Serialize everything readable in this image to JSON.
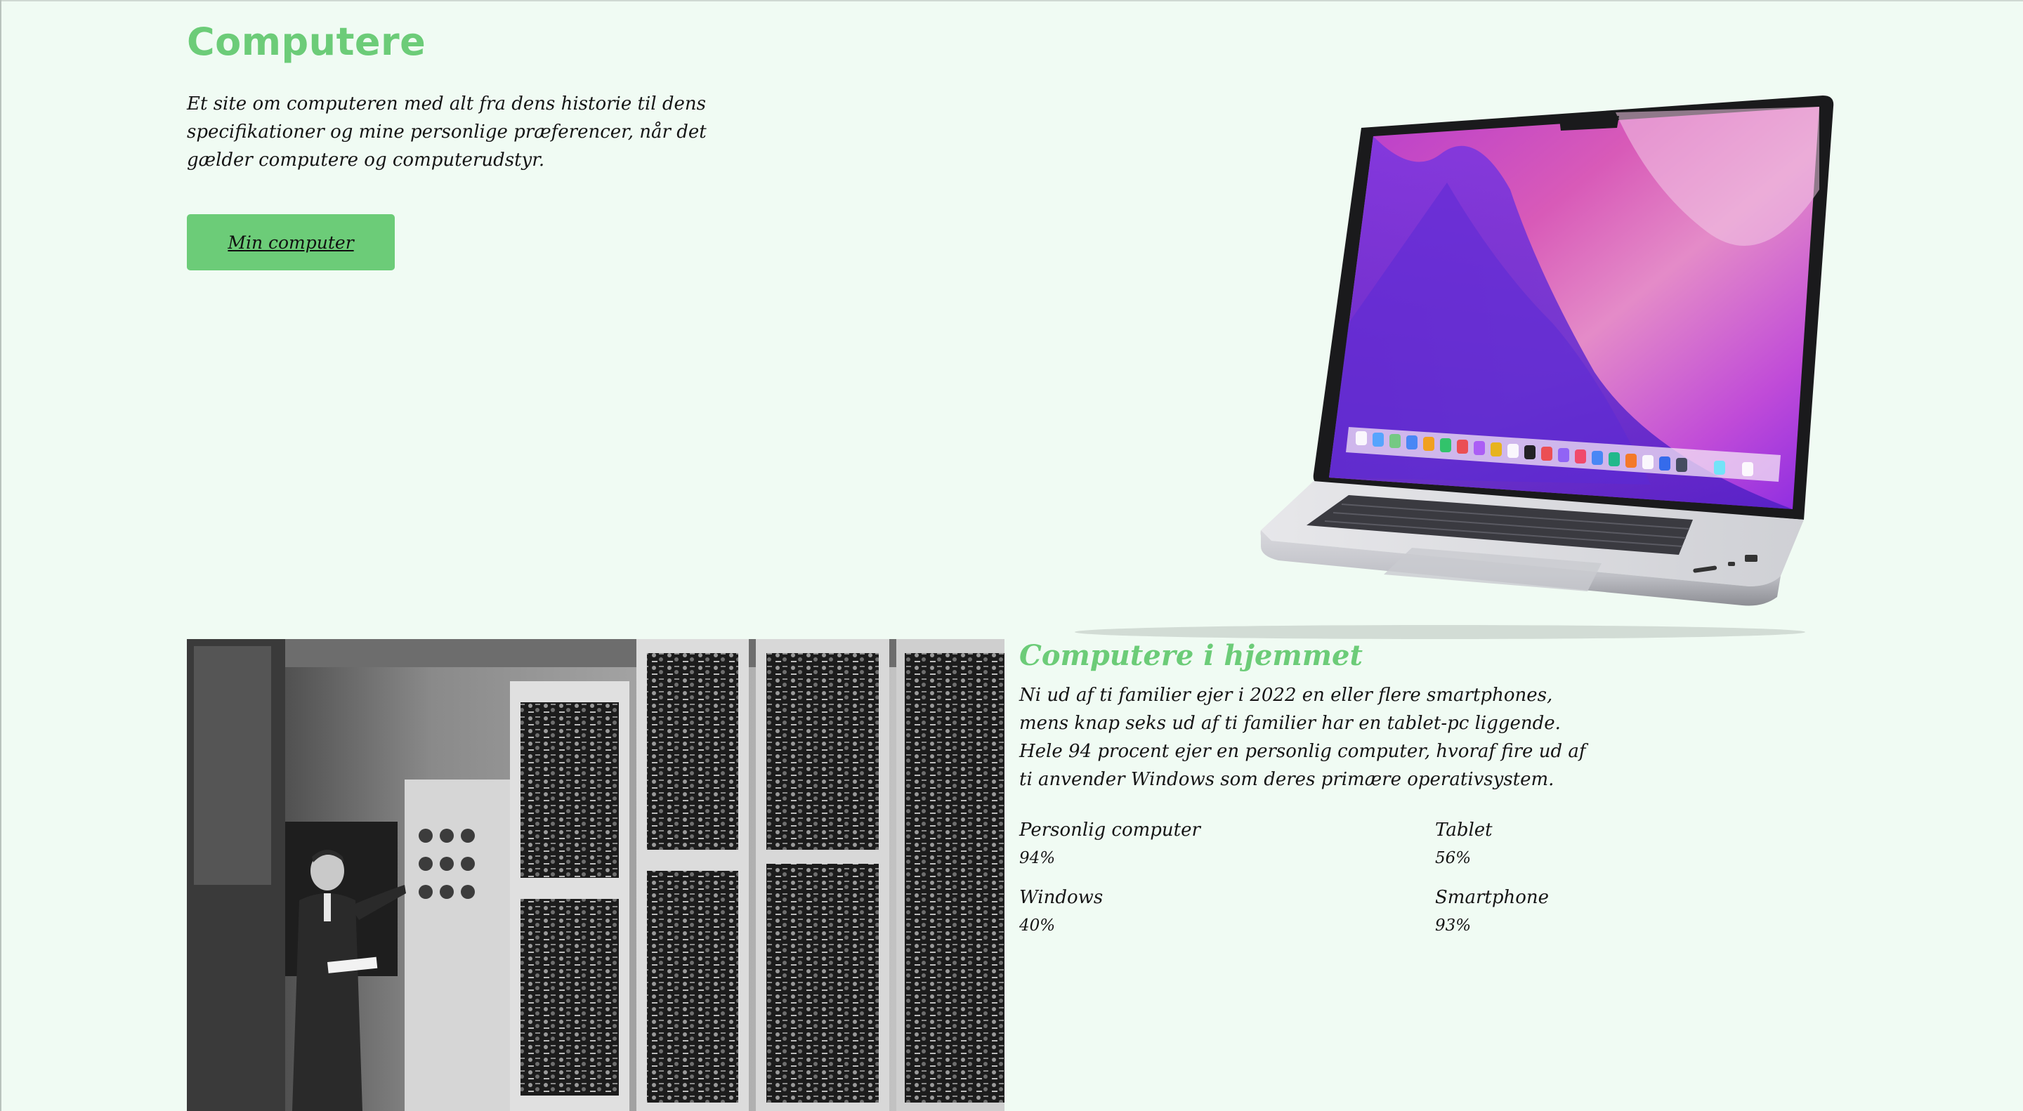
{
  "hero": {
    "title": "Computere",
    "intro": "Et site om computeren med alt fra dens historie til dens specifikationer og mine personlige præferencer, når det gælder computere og computerudstyr.",
    "button_label": "Min computer"
  },
  "home_section": {
    "title": "Computere i hjemmet",
    "body": "Ni ud af ti familier ejer i 2022 en eller flere smartphones, mens knap seks ud af ti familier har en tablet-pc liggende. Hele 94 procent ejer en personlig computer, hvoraf fire ud af ti anvender Windows som deres primære operativsystem.",
    "stats": [
      {
        "label": "Personlig computer",
        "value": "94%"
      },
      {
        "label": "Tablet",
        "value": "56%"
      },
      {
        "label": "Windows",
        "value": "40%"
      },
      {
        "label": "Smartphone",
        "value": "93%"
      }
    ]
  },
  "colors": {
    "accent": "#6ccc78",
    "background": "#f0fbf3",
    "text": "#151515"
  },
  "images": {
    "laptop": "laptop-illustration",
    "history": "mainframe-photo"
  }
}
